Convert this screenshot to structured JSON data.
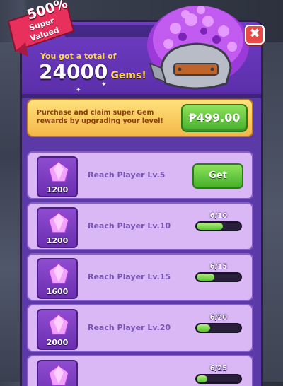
{
  "badge": {
    "percent": "500%",
    "line1": "Super",
    "line2": "Valued"
  },
  "header": {
    "subtitle": "You got a total of",
    "total": "24000",
    "unit": "Gems!"
  },
  "close": {
    "icon": "close-icon",
    "label": "✖"
  },
  "purchase": {
    "text": "Purchase and claim super Gem rewards by upgrading your level!",
    "price": "₱499.00"
  },
  "rewards": [
    {
      "gems": "1200",
      "label": "Reach Player Lv.5",
      "state": "get",
      "button": "Get"
    },
    {
      "gems": "1200",
      "label": "Reach Player Lv.10",
      "state": "progress",
      "progress": "6/10",
      "fraction": 0.6
    },
    {
      "gems": "1600",
      "label": "Reach Player Lv.15",
      "state": "progress",
      "progress": "6/15",
      "fraction": 0.4
    },
    {
      "gems": "2000",
      "label": "Reach Player Lv.20",
      "state": "progress",
      "progress": "6/20",
      "fraction": 0.3
    },
    {
      "gems": "",
      "label": "",
      "state": "progress",
      "progress": "6/25",
      "fraction": 0.24
    }
  ],
  "colors": {
    "accent": "#5b3aa8",
    "banner": "#f4b84a",
    "button_green": "#46b02c",
    "row": "#d9b8f5"
  }
}
